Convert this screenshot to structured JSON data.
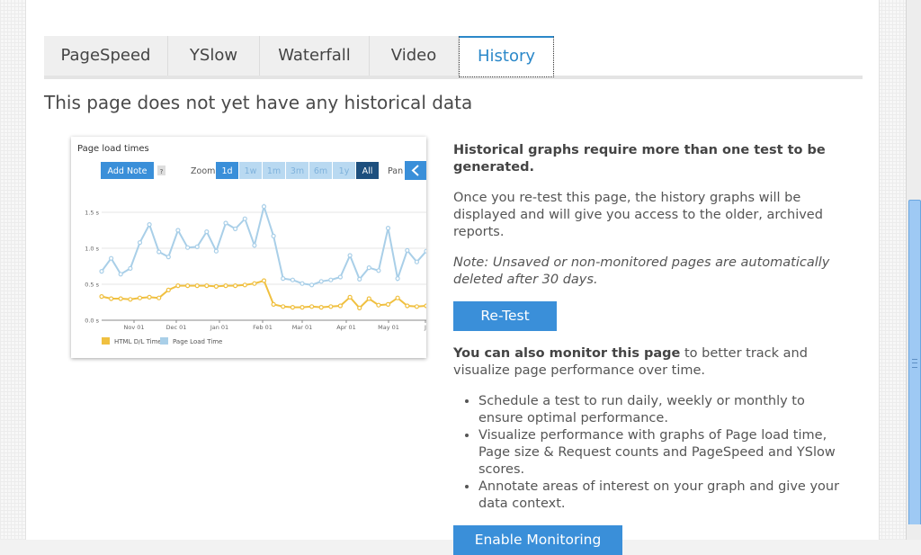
{
  "tabs": [
    {
      "label": "PageSpeed",
      "active": false
    },
    {
      "label": "YSlow",
      "active": false
    },
    {
      "label": "Waterfall",
      "active": false
    },
    {
      "label": "Video",
      "active": false
    },
    {
      "label": "History",
      "active": true
    }
  ],
  "heading": "This page does not yet have any historical data",
  "chart": {
    "title": "Page load times",
    "add_note": "Add Note",
    "help": "?",
    "zoom_label": "Zoom",
    "zoom_options": [
      "1d",
      "1w",
      "1m",
      "3m",
      "6m",
      "1y",
      "All"
    ],
    "pan_label": "Pan",
    "legend": [
      "HTML D/L Time",
      "Page Load Time"
    ],
    "colors": {
      "html": "#f0c040",
      "page": "#a9cfe8",
      "accent": "#3a8fd9"
    }
  },
  "chart_data": {
    "type": "line",
    "title": "Page load times",
    "x_ticks": [
      "Nov 01",
      "Dec 01",
      "Jan 01",
      "Feb 01",
      "Mar 01",
      "Apr 01",
      "May 01",
      "J"
    ],
    "y_ticks": [
      "0.0 s",
      "0.5 s",
      "1.0 s",
      "1.5 s"
    ],
    "ylim": [
      0,
      1.8
    ],
    "series": [
      {
        "name": "Page Load Time",
        "values": [
          0.68,
          0.86,
          0.64,
          0.72,
          1.08,
          1.33,
          0.95,
          0.88,
          1.25,
          1.01,
          1.02,
          1.23,
          0.96,
          1.35,
          1.27,
          1.41,
          1.04,
          1.58,
          1.17,
          0.58,
          0.56,
          0.51,
          0.49,
          0.54,
          0.56,
          0.6,
          0.9,
          0.57,
          0.73,
          0.69,
          1.28,
          0.58,
          0.97,
          0.81,
          0.96
        ]
      },
      {
        "name": "HTML D/L Time",
        "values": [
          0.33,
          0.3,
          0.3,
          0.29,
          0.31,
          0.32,
          0.31,
          0.42,
          0.48,
          0.48,
          0.48,
          0.48,
          0.47,
          0.48,
          0.48,
          0.49,
          0.51,
          0.55,
          0.22,
          0.19,
          0.18,
          0.18,
          0.19,
          0.18,
          0.19,
          0.2,
          0.32,
          0.17,
          0.3,
          0.21,
          0.22,
          0.31,
          0.2,
          0.19,
          0.2
        ]
      }
    ]
  },
  "info": {
    "requirement": "Historical graphs require more than one test to be generated.",
    "retest_text": "Once you re-test this page, the history graphs will be displayed and will give you access to the older, archived reports.",
    "note": "Note: Unsaved or non-monitored pages are automatically deleted after 30 days.",
    "retest_button": "Re-Test",
    "monitor_bold": "You can also monitor this page",
    "monitor_rest": " to better track and visualize page performance over time.",
    "bullets": [
      "Schedule a test to run daily, weekly or monthly to ensure optimal performance.",
      "Visualize performance with graphs of Page load time, Page size & Request counts and PageSpeed and YSlow scores.",
      "Annotate areas of interest on your graph and give your data context."
    ],
    "enable_button": "Enable Monitoring"
  }
}
